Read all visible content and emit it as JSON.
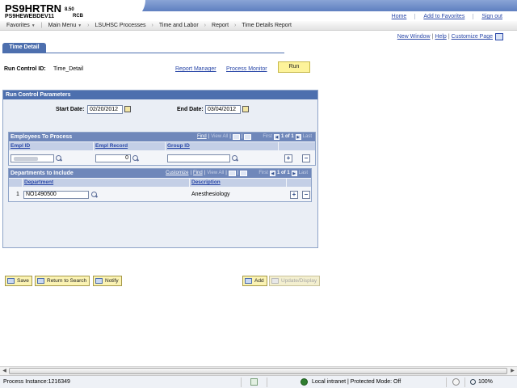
{
  "header": {
    "system_name": "PS9HRTRN",
    "version": "8.50",
    "database": "PS9HEWEBDEV11",
    "user": "RCB",
    "links": [
      "Home",
      "Add to Favorites",
      "Sign out"
    ]
  },
  "menu": {
    "items": [
      "Favorites",
      "Main Menu",
      "LSUHSC Processes",
      "Time and Labor",
      "Report",
      "Time Details Report"
    ]
  },
  "page_links": [
    "New Window",
    "Help",
    "Customize Page"
  ],
  "tab": {
    "label": "Time Detail"
  },
  "run_control": {
    "label": "Run Control ID:",
    "value": "Time_Detail",
    "report_manager": "Report Manager",
    "process_monitor": "Process Monitor",
    "run_label": "Run"
  },
  "params": {
    "title": "Run Control Parameters",
    "start_label": "Start Date:",
    "start_value": "02/20/2012",
    "end_label": "End Date:",
    "end_value": "03/04/2012"
  },
  "employees_grid": {
    "title": "Employees To Process",
    "find": "Find",
    "view_all": "View All",
    "first": "First",
    "range": "1 of 1",
    "last": "Last",
    "columns": [
      "Empl ID",
      "Empl Record",
      "Group ID"
    ],
    "row": {
      "empl_record": "0",
      "group_id": ""
    }
  },
  "departments_grid": {
    "title": "Departments to Include",
    "customize": "Customize",
    "find": "Find",
    "view_all": "View All",
    "first": "First",
    "range": "1 of 1",
    "last": "Last",
    "columns": [
      "Department",
      "Description"
    ],
    "row": {
      "num": "1",
      "department": "NO1490500",
      "description": "Anesthesiology"
    }
  },
  "buttons": {
    "save": "Save",
    "return_to_search": "Return to Search",
    "notify": "Notify",
    "add": "Add",
    "update_display": "Update/Display"
  },
  "status_bar": {
    "process_instance": "Process Instance:1216349",
    "zone": "Local intranet | Protected Mode: Off",
    "zoom": "100%"
  }
}
